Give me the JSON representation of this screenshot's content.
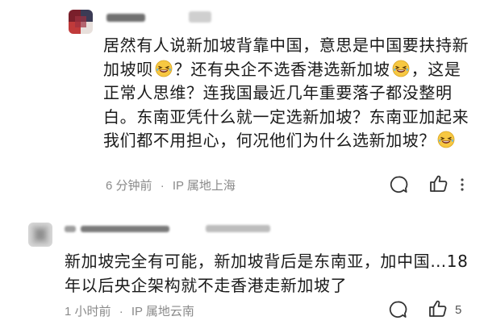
{
  "comments": [
    {
      "username_masked": true,
      "segments": [
        {
          "type": "text",
          "value": "居然有人说新加坡背靠中国，意思是中国要扶持新加坡呗"
        },
        {
          "type": "emoji",
          "name": "rofl-emoji"
        },
        {
          "type": "text",
          "value": "？还有央企不选香港选新加坡"
        },
        {
          "type": "emoji",
          "name": "rofl-emoji"
        },
        {
          "type": "text",
          "value": "，这是正常人思维？连我国最近几年重要落子都没整明白。东南亚凭什么就一定选新加坡？东南亚加起来我们都不用担心，何况他们为什么选新加坡？"
        },
        {
          "type": "emoji",
          "name": "rofl-emoji"
        }
      ],
      "time": "6 分钟前",
      "separator": "·",
      "ip_location": "IP 属地上海",
      "like_count": ""
    },
    {
      "username_masked": true,
      "segments": [
        {
          "type": "text",
          "value": "新加坡完全有可能，新加坡背后是东南亚，加中国…18年以后央企架构就不走香港走新加坡了"
        }
      ],
      "time": "1 小时前",
      "separator": "·",
      "ip_location": "IP 属地云南",
      "like_count": "5"
    }
  ],
  "colors": {
    "meta_text": "#8a8a8a",
    "body_text": "#1a1a1a",
    "icon_stroke": "#333333",
    "emoji_yellow": "#f7c842"
  }
}
